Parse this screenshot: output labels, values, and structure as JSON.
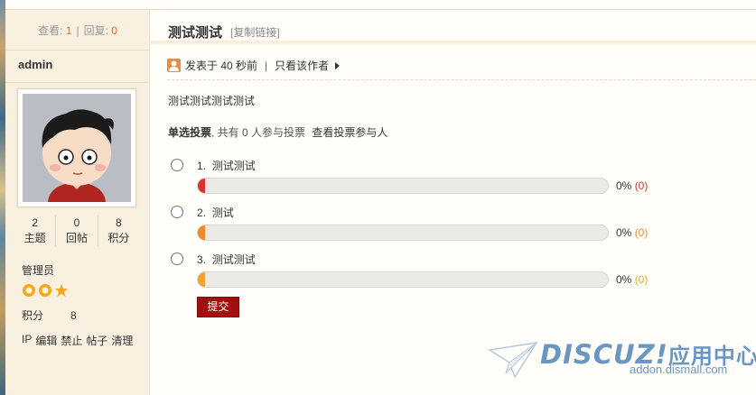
{
  "sidebar": {
    "stats": {
      "views_label": "查看:",
      "views": "1",
      "replies_label": "回复:",
      "replies": "0"
    },
    "author": "admin",
    "counts": [
      {
        "value": "2",
        "label": "主题"
      },
      {
        "value": "0",
        "label": "回帖"
      },
      {
        "value": "8",
        "label": "积分"
      }
    ],
    "role": "管理员",
    "points_label": "积分",
    "points_value": "8",
    "admin_links": [
      "IP",
      "编辑",
      "禁止",
      "帖子",
      "清理"
    ]
  },
  "post": {
    "title": "测试测试",
    "copy_link": "[复制链接]",
    "posted": "发表于 40 秒前",
    "author_only": "只看该作者",
    "body": "测试测试测试测试"
  },
  "poll": {
    "type_label": "单选投票",
    "summary": ", 共有 0 人参与投票",
    "view_voters": "查看投票参与人",
    "options": [
      {
        "number": "1.",
        "text": "测试测试",
        "percent": "0%",
        "count": "(0)",
        "color": "#d9342b"
      },
      {
        "number": "2.",
        "text": "测试",
        "percent": "0%",
        "count": "(0)",
        "color": "#ef8a2b"
      },
      {
        "number": "3.",
        "text": "测试测试",
        "percent": "0%",
        "count": "(0)",
        "color": "#f0a32f"
      }
    ],
    "submit": "提交"
  },
  "watermark": {
    "brand": "DISCUZ!",
    "cn": "应用中心",
    "url": "addon.dismall.com"
  },
  "colors": {
    "accent": "#a40e0e",
    "sidebar_bg": "#faf0e0",
    "link_num": "#e36a47"
  }
}
